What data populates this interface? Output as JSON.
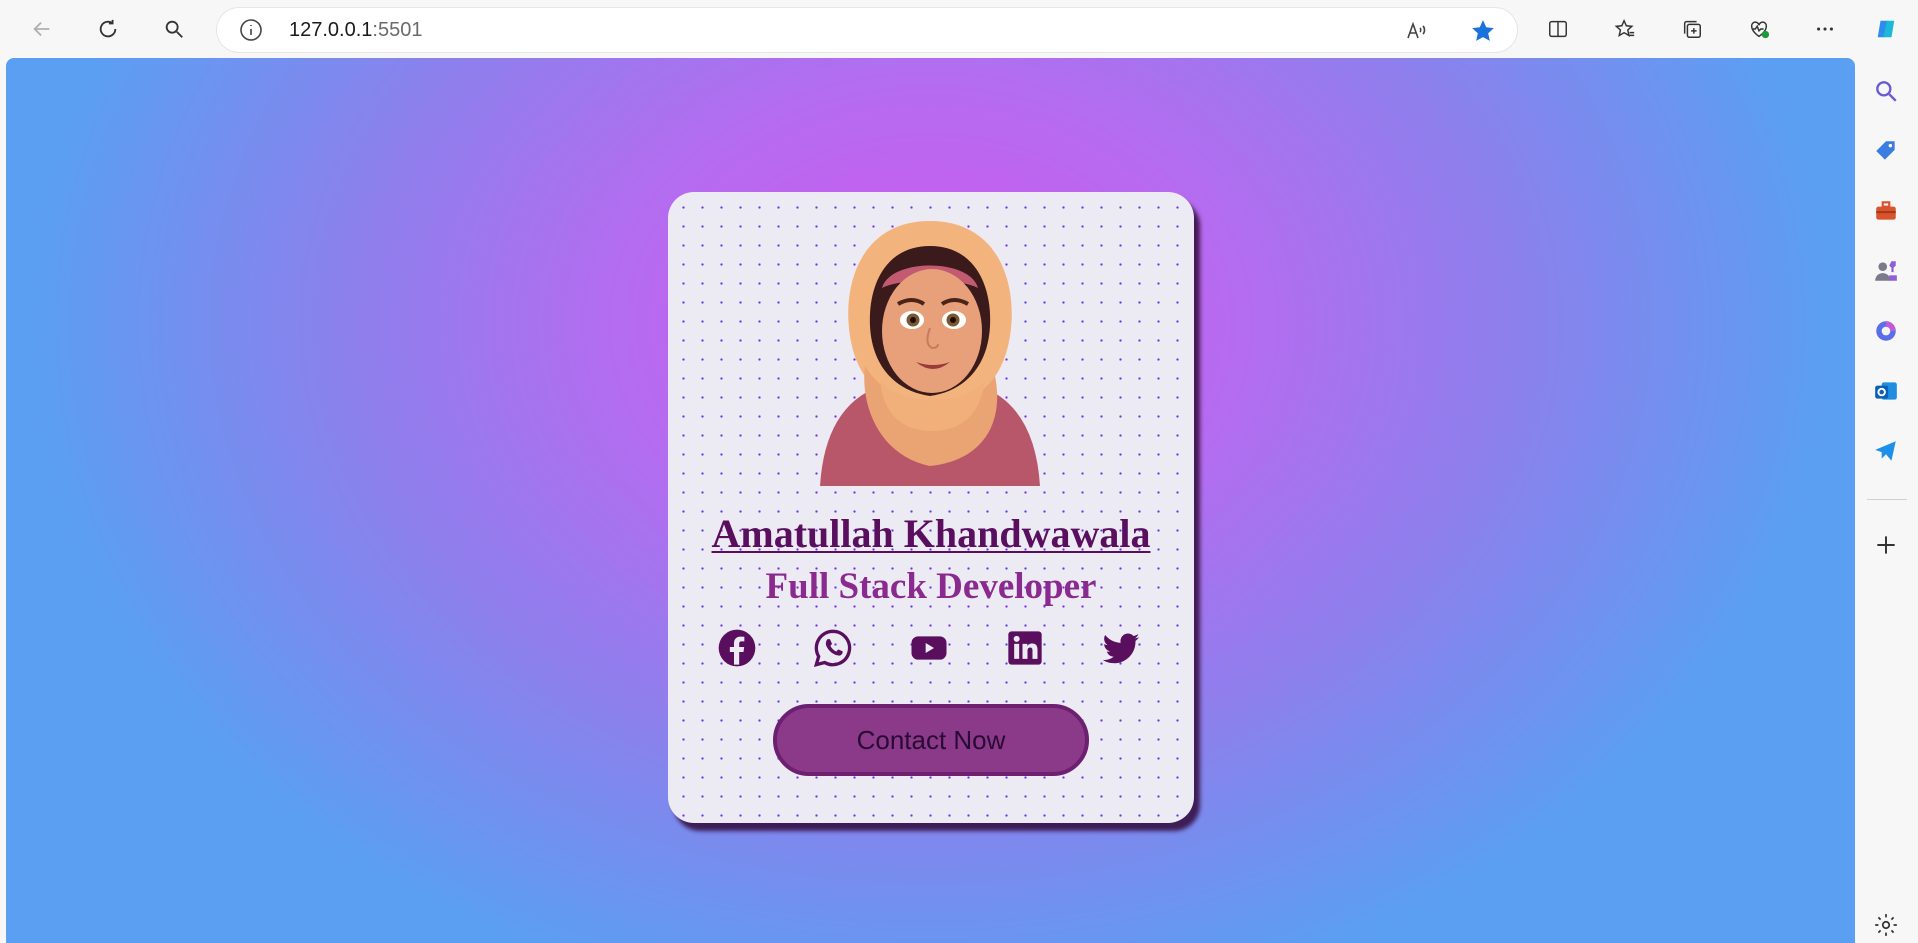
{
  "browser": {
    "url_host": "127.0.0.1",
    "url_port": ":5501",
    "icons": {
      "back": "back-arrow-icon",
      "refresh": "refresh-icon",
      "search": "search-icon",
      "info": "info-icon",
      "read_aloud": "read-aloud-icon",
      "favorite": "star-icon",
      "split": "split-screen-icon",
      "favorites": "favorites-icon",
      "collections": "collections-icon",
      "health": "browser-essentials-icon",
      "more": "more-icon",
      "copilot": "copilot-icon"
    }
  },
  "sidebar": {
    "items": [
      "search-icon",
      "shopping-tag-icon",
      "tools-icon",
      "games-icon",
      "copilot-icon",
      "outlook-icon",
      "telegram-icon",
      "add-icon",
      "settings-icon"
    ]
  },
  "card": {
    "name": "Amatullah Khandwawala",
    "title": "Full Stack Developer",
    "contact_label": "Contact Now",
    "socials": [
      "facebook-icon",
      "whatsapp-icon",
      "youtube-icon",
      "linkedin-icon",
      "twitter-icon"
    ],
    "colors": {
      "primary": "#5a0f5e",
      "accent": "#8a2a8e",
      "button": "#8a3a88"
    }
  }
}
